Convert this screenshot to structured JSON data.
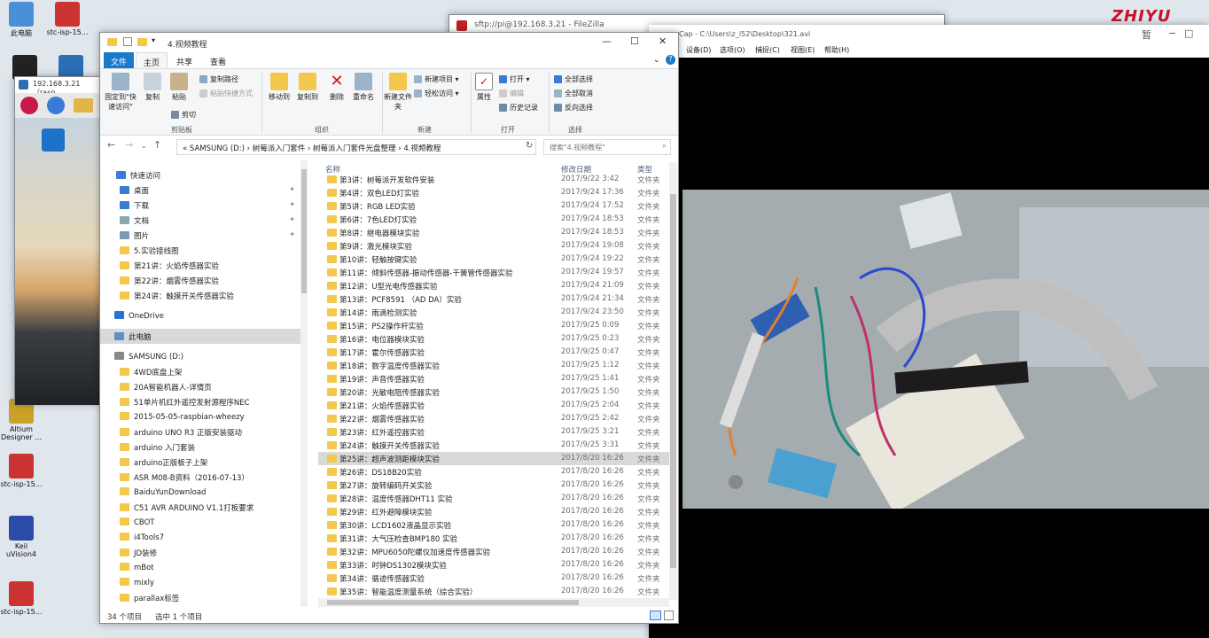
{
  "desktop": {
    "icons": [
      {
        "label": "此电脑",
        "color": "#4a90d9"
      },
      {
        "label": "stc-isp-15...",
        "color": "#c33"
      },
      {
        "label": "",
        "color": "#222"
      },
      {
        "label": "",
        "color": "#2a6fb5"
      },
      {
        "label": "Altium Designer ...",
        "color": "#c9a227"
      },
      {
        "label": "stc-isp-15...",
        "color": "#c33"
      },
      {
        "label": "Keil uVision4",
        "color": "#2c4aa8"
      },
      {
        "label": "stc-isp-15...",
        "color": "#c33"
      }
    ],
    "watermark": "ZHIYU"
  },
  "filezilla": {
    "title": "sftp://pi@192.168.3.21 - FileZilla"
  },
  "capture": {
    "title": "Cap - C:\\Users\\z_l52\\Desktop\\321.avi",
    "menu": [
      "设备(D)",
      "选项(O)",
      "捕捉(C)",
      "视图(E)",
      "帮助(H)"
    ],
    "controls": [
      "暂",
      "−",
      "□"
    ]
  },
  "rpi": {
    "title": "192.168.3.21（rasp"
  },
  "explorer": {
    "title": "4.视频教程",
    "controls": {
      "min": "—",
      "max": "☐",
      "close": "✕"
    },
    "tabs": [
      "文件",
      "主页",
      "共享",
      "查看"
    ],
    "ribbon": {
      "pin_label": "固定到\"快速访问\"",
      "copy": "复制",
      "paste": "粘贴",
      "copy_path": "复制路径",
      "paste_shortcut": "粘贴快捷方式",
      "cut": "剪切",
      "clipboard": "剪贴板",
      "move_to": "移动到",
      "copy_to": "复制到",
      "delete": "删除",
      "rename": "重命名",
      "organize": "组织",
      "new_folder": "新建文件夹",
      "new_item": "新建项目",
      "easy_access": "轻松访问",
      "new": "新建",
      "properties": "属性",
      "open": "打开",
      "edit": "编辑",
      "history": "历史记录",
      "open_group": "打开",
      "select_all": "全部选择",
      "select_none": "全部取消",
      "invert": "反向选择",
      "select": "选择"
    },
    "address": "« SAMSUNG (D:)  ›  树莓派入门套件  ›  树莓派入门套件光盘整理  ›  4.视频教程",
    "search_placeholder": "搜索\"4.视频教程\"",
    "nav": [
      {
        "label": "快速访问",
        "type": "star",
        "indent": 18
      },
      {
        "label": "桌面",
        "type": "blue",
        "indent": 22,
        "pin": true
      },
      {
        "label": "下载",
        "type": "down",
        "indent": 22,
        "pin": true
      },
      {
        "label": "文档",
        "type": "doc",
        "indent": 22,
        "pin": true
      },
      {
        "label": "图片",
        "type": "pic",
        "indent": 22,
        "pin": true
      },
      {
        "label": "5.实验接线图",
        "type": "folder",
        "indent": 22
      },
      {
        "label": "第21讲：火焰传感器实验",
        "type": "folder",
        "indent": 22
      },
      {
        "label": "第22讲：烟雾传感器实验",
        "type": "folder",
        "indent": 22
      },
      {
        "label": "第24讲：触摸开关传感器实验",
        "type": "folder",
        "indent": 22
      },
      {
        "label": "",
        "type": "gap",
        "indent": 0
      },
      {
        "label": "OneDrive",
        "type": "cloud",
        "indent": 16
      },
      {
        "label": "",
        "type": "gap",
        "indent": 0
      },
      {
        "label": "此电脑",
        "type": "pc",
        "indent": 16,
        "hl": true
      },
      {
        "label": "",
        "type": "gap",
        "indent": 0
      },
      {
        "label": "SAMSUNG (D:)",
        "type": "drive",
        "indent": 16
      },
      {
        "label": "4WD底盘上架",
        "type": "folder",
        "indent": 22
      },
      {
        "label": "20A智能机器人-详情页",
        "type": "folder",
        "indent": 22
      },
      {
        "label": "51单片机红外遥控发射源程序NEC",
        "type": "folder",
        "indent": 22
      },
      {
        "label": "2015-05-05-raspbian-wheezy",
        "type": "folder",
        "indent": 22
      },
      {
        "label": "arduino UNO R3 正版安装驱动",
        "type": "folder",
        "indent": 22
      },
      {
        "label": "arduino 入门套装",
        "type": "folder",
        "indent": 22
      },
      {
        "label": "arduino正版板子上架",
        "type": "folder",
        "indent": 22
      },
      {
        "label": "ASR M08-B资料（2016-07-13）",
        "type": "folder",
        "indent": 22
      },
      {
        "label": "BaiduYunDownload",
        "type": "folder",
        "indent": 22
      },
      {
        "label": "C51 AVR ARDUINO V1.1打板要求",
        "type": "folder",
        "indent": 22
      },
      {
        "label": "CBOT",
        "type": "folder",
        "indent": 22
      },
      {
        "label": "i4Tools7",
        "type": "folder",
        "indent": 22
      },
      {
        "label": "JD装修",
        "type": "folder",
        "indent": 22
      },
      {
        "label": "mBot",
        "type": "folder",
        "indent": 22
      },
      {
        "label": "mixly",
        "type": "folder",
        "indent": 22
      },
      {
        "label": "parallax标签",
        "type": "folder",
        "indent": 22
      }
    ],
    "columns": {
      "name": "名称",
      "date": "修改日期",
      "type": "类型"
    },
    "files": [
      {
        "name": "第3讲：树莓派开发软件安装",
        "date": "2017/9/22 3:42",
        "type": "文件夹"
      },
      {
        "name": "第4讲：双色LED灯实验",
        "date": "2017/9/24 17:36",
        "type": "文件夹"
      },
      {
        "name": "第5讲：RGB LED实验",
        "date": "2017/9/24 17:52",
        "type": "文件夹"
      },
      {
        "name": "第6讲：7色LED灯实验",
        "date": "2017/9/24 18:53",
        "type": "文件夹"
      },
      {
        "name": "第8讲：继电器模块实验",
        "date": "2017/9/24 18:53",
        "type": "文件夹"
      },
      {
        "name": "第9讲：激光模块实验",
        "date": "2017/9/24 19:08",
        "type": "文件夹"
      },
      {
        "name": "第10讲：轻触按键实验",
        "date": "2017/9/24 19:22",
        "type": "文件夹"
      },
      {
        "name": "第11讲：倾斜传感器-振动传感器-干簧管传感器实验",
        "date": "2017/9/24 19:57",
        "type": "文件夹"
      },
      {
        "name": "第12讲：U型光电传感器实验",
        "date": "2017/9/24 21:09",
        "type": "文件夹"
      },
      {
        "name": "第13讲：PCF8591 （AD DA）实验",
        "date": "2017/9/24 21:34",
        "type": "文件夹"
      },
      {
        "name": "第14讲：雨滴检测实验",
        "date": "2017/9/24 23:50",
        "type": "文件夹"
      },
      {
        "name": "第15讲：PS2操作杆实验",
        "date": "2017/9/25 0:09",
        "type": "文件夹"
      },
      {
        "name": "第16讲：电位器模块实验",
        "date": "2017/9/25 0:23",
        "type": "文件夹"
      },
      {
        "name": "第17讲：霍尔传感器实验",
        "date": "2017/9/25 0:47",
        "type": "文件夹"
      },
      {
        "name": "第18讲：数字温度传感器实验",
        "date": "2017/9/25 1:12",
        "type": "文件夹"
      },
      {
        "name": "第19讲：声音传感器实验",
        "date": "2017/9/25 1:41",
        "type": "文件夹"
      },
      {
        "name": "第20讲：光敏电阻传感器实验",
        "date": "2017/9/25 1:50",
        "type": "文件夹"
      },
      {
        "name": "第21讲：火焰传感器实验",
        "date": "2017/9/25 2:04",
        "type": "文件夹"
      },
      {
        "name": "第22讲：烟雾传感器实验",
        "date": "2017/9/25 2:42",
        "type": "文件夹"
      },
      {
        "name": "第23讲：红外遥控器实验",
        "date": "2017/9/25 3:21",
        "type": "文件夹"
      },
      {
        "name": "第24讲：触摸开关传感器实验",
        "date": "2017/9/25 3:31",
        "type": "文件夹"
      },
      {
        "name": "第25讲：超声波测距模块实验",
        "date": "2017/8/20 16:26",
        "type": "文件夹",
        "selected": true
      },
      {
        "name": "第26讲：DS18B20实验",
        "date": "2017/8/20 16:26",
        "type": "文件夹"
      },
      {
        "name": "第27讲：旋转编码开关实验",
        "date": "2017/8/20 16:26",
        "type": "文件夹"
      },
      {
        "name": "第28讲：温度传感器DHT11 实验",
        "date": "2017/8/20 16:26",
        "type": "文件夹"
      },
      {
        "name": "第29讲：红外避障模块实验",
        "date": "2017/8/20 16:26",
        "type": "文件夹"
      },
      {
        "name": "第30讲：LCD1602液晶显示实验",
        "date": "2017/8/20 16:26",
        "type": "文件夹"
      },
      {
        "name": "第31讲：大气压检查BMP180 实验",
        "date": "2017/8/20 16:26",
        "type": "文件夹"
      },
      {
        "name": "第32讲：MPU6050陀螺仪加速度传感器实验",
        "date": "2017/8/20 16:26",
        "type": "文件夹"
      },
      {
        "name": "第33讲：时钟DS1302模块实验",
        "date": "2017/8/20 16:26",
        "type": "文件夹"
      },
      {
        "name": "第34讲：循迹传感器实验",
        "date": "2017/8/20 16:26",
        "type": "文件夹"
      },
      {
        "name": "第35讲：智能温度测量系统（综合实验）",
        "date": "2017/8/20 16:26",
        "type": "文件夹"
      }
    ],
    "status_count": "34 个项目",
    "status_selected": "选中 1 个项目"
  }
}
